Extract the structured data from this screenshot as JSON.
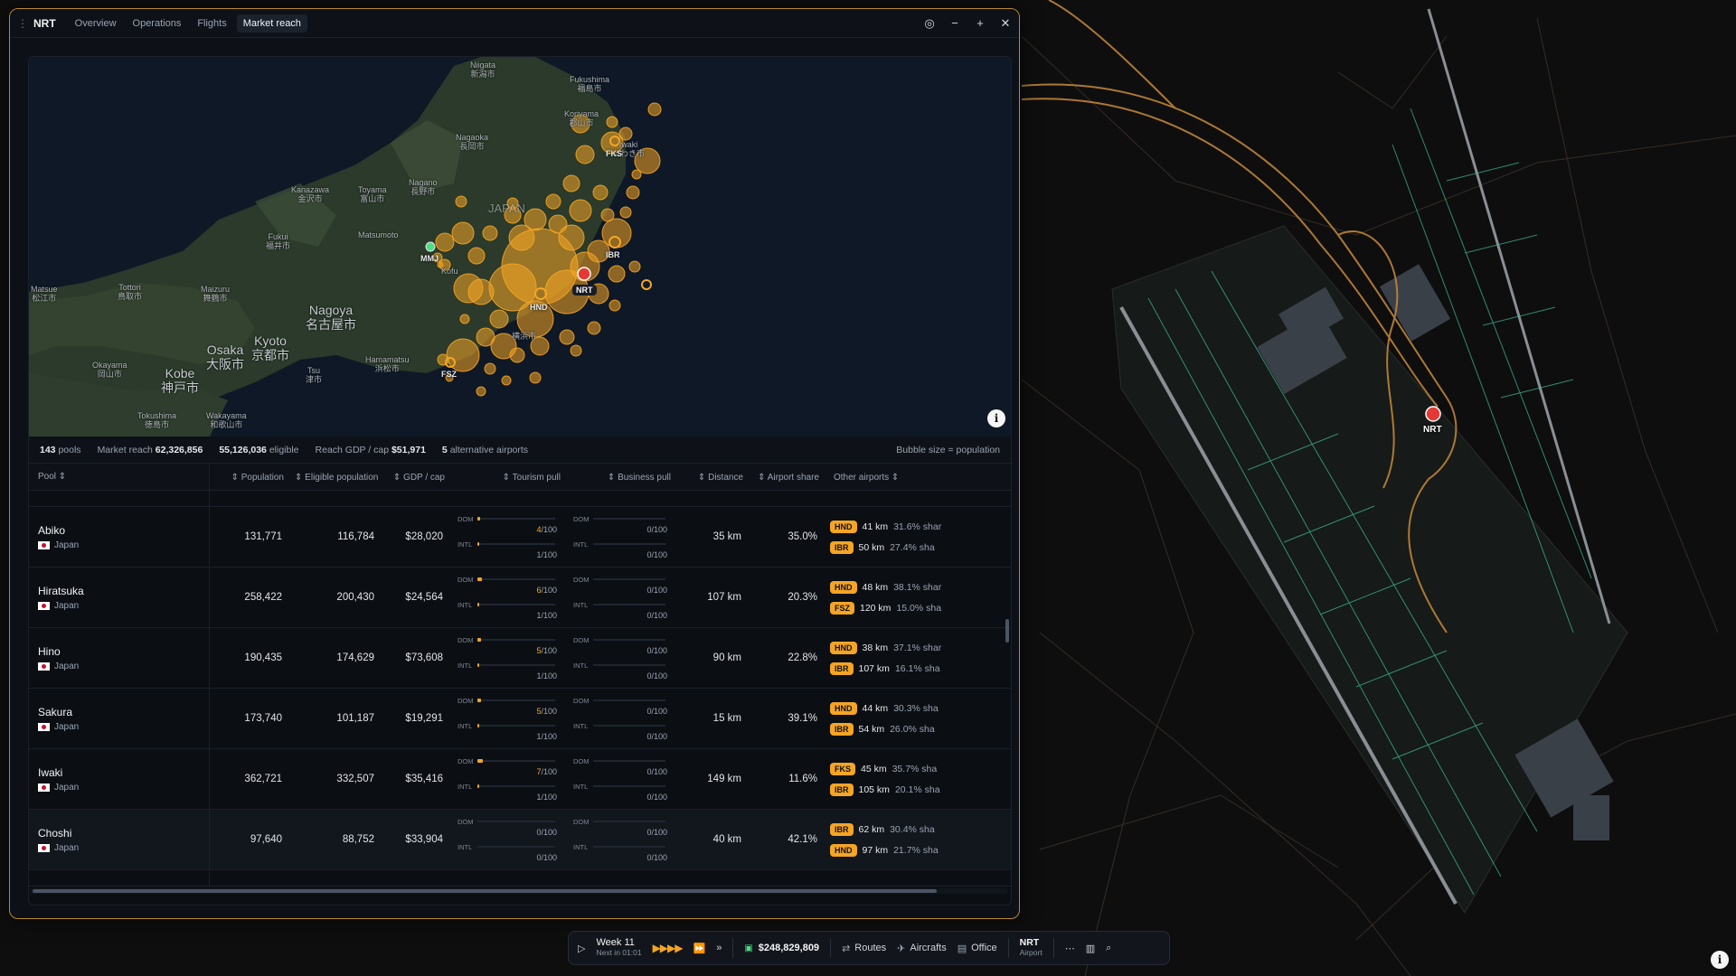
{
  "window": {
    "title": "NRT",
    "tabs": [
      "Overview",
      "Operations",
      "Flights",
      "Market reach"
    ],
    "active_tab": "Market reach"
  },
  "map": {
    "labels": {
      "niigata": "Niigata\n新潟市",
      "fukushima": "Fukushima\n福島市",
      "koriyama": "Koriyama\n郡山市",
      "nagaoka": "Nagaoka\n長岡市",
      "iwaki": "Iwaki\nいわき市",
      "nagano": "Nagano\n長野市",
      "kanazawa": "Kanazawa\n金沢市",
      "toyama": "Toyama\n富山市",
      "japan": "JAPAN",
      "fukui": "Fukui\n福井市",
      "matsumoto": "Matsumoto",
      "kofu": "Kofu",
      "matsue": "Matsue\n松江市",
      "tottori": "Tottori\n鳥取市",
      "maizuru": "Maizuru\n舞鶴市",
      "nagoya": "Nagoya\n名古屋市",
      "kyoto": "Kyoto\n京都市",
      "osaka": "Osaka\n大阪市",
      "kobe": "Kobe\n神戸市",
      "okayama": "Okayama\n岡山市",
      "tsu": "Tsu\n津市",
      "hamamatsu": "Hamamatsu\n浜松市",
      "tokushima": "Tokushima\n徳島市",
      "wakayama": "Wakayama\n和歌山市",
      "yokohama": "横浜市"
    },
    "airports": [
      "NRT",
      "HND",
      "IBR",
      "FKS",
      "MMJ",
      "FSZ"
    ],
    "info_icon": "info-icon"
  },
  "stats": {
    "pools_value": "143",
    "pools_label": "pools",
    "reach_label": "Market reach",
    "reach_value": "62,326,856",
    "eligible_value": "55,126,036",
    "eligible_label": "eligible",
    "gdp_label": "Reach GDP / cap",
    "gdp_value": "$51,971",
    "alt_value": "5",
    "alt_label": "alternative airports",
    "bubble_note": "Bubble size = population"
  },
  "columns": [
    "Pool",
    "Population",
    "Eligible population",
    "GDP / cap",
    "Tourism pull",
    "Business pull",
    "Distance",
    "Airport share",
    "Other airports"
  ],
  "rows": [
    {
      "name": "Abiko",
      "country": "Japan",
      "population": "131,771",
      "eligible": "116,784",
      "gdp": "$28,020",
      "t_dom": "4",
      "t_intl": "1",
      "b_dom": "0",
      "b_intl": "0",
      "t_dom_pct": 0.04,
      "t_intl_pct": 0.01,
      "distance": "35 km",
      "share": "35.0%",
      "others": [
        {
          "code": "HND",
          "dist": "41 km",
          "share": "31.6% shar"
        },
        {
          "code": "IBR",
          "dist": "50 km",
          "share": "27.4% sha"
        }
      ]
    },
    {
      "name": "Hiratsuka",
      "country": "Japan",
      "population": "258,422",
      "eligible": "200,430",
      "gdp": "$24,564",
      "t_dom": "6",
      "t_intl": "1",
      "b_dom": "0",
      "b_intl": "0",
      "t_dom_pct": 0.06,
      "t_intl_pct": 0.01,
      "distance": "107 km",
      "share": "20.3%",
      "others": [
        {
          "code": "HND",
          "dist": "48 km",
          "share": "38.1% shar"
        },
        {
          "code": "FSZ",
          "dist": "120 km",
          "share": "15.0% sha"
        }
      ]
    },
    {
      "name": "Hino",
      "country": "Japan",
      "population": "190,435",
      "eligible": "174,629",
      "gdp": "$73,608",
      "t_dom": "5",
      "t_intl": "1",
      "b_dom": "0",
      "b_intl": "0",
      "t_dom_pct": 0.05,
      "t_intl_pct": 0.01,
      "distance": "90 km",
      "share": "22.8%",
      "others": [
        {
          "code": "HND",
          "dist": "38 km",
          "share": "37.1% shar"
        },
        {
          "code": "IBR",
          "dist": "107 km",
          "share": "16.1% sha"
        }
      ]
    },
    {
      "name": "Sakura",
      "country": "Japan",
      "population": "173,740",
      "eligible": "101,187",
      "gdp": "$19,291",
      "t_dom": "5",
      "t_intl": "1",
      "b_dom": "0",
      "b_intl": "0",
      "t_dom_pct": 0.05,
      "t_intl_pct": 0.01,
      "distance": "15 km",
      "share": "39.1%",
      "others": [
        {
          "code": "HND",
          "dist": "44 km",
          "share": "30.3% sha"
        },
        {
          "code": "IBR",
          "dist": "54 km",
          "share": "26.0% sha"
        }
      ]
    },
    {
      "name": "Iwaki",
      "country": "Japan",
      "population": "362,721",
      "eligible": "332,507",
      "gdp": "$35,416",
      "t_dom": "7",
      "t_intl": "1",
      "b_dom": "0",
      "b_intl": "0",
      "t_dom_pct": 0.07,
      "t_intl_pct": 0.01,
      "distance": "149 km",
      "share": "11.6%",
      "others": [
        {
          "code": "FKS",
          "dist": "45 km",
          "share": "35.7% sha"
        },
        {
          "code": "IBR",
          "dist": "105 km",
          "share": "20.1% sha"
        }
      ]
    },
    {
      "name": "Choshi",
      "country": "Japan",
      "population": "97,640",
      "eligible": "88,752",
      "gdp": "$33,904",
      "t_dom": "0",
      "t_intl": "0",
      "b_dom": "0",
      "b_intl": "0",
      "t_dom_pct": 0,
      "t_intl_pct": 0,
      "distance": "40 km",
      "share": "42.1%",
      "others": [
        {
          "code": "IBR",
          "dist": "62 km",
          "share": "30.4% sha"
        },
        {
          "code": "HND",
          "dist": "97 km",
          "share": "21.7% sha"
        }
      ]
    }
  ],
  "pull_labels": {
    "dom": "DOM",
    "intl": "INTL",
    "max": "/100"
  },
  "dock": {
    "week": "Week 11",
    "next": "Next in 01:01",
    "speed": "▶▶▶▶",
    "money": "$248,829,809",
    "routes": "Routes",
    "aircrafts": "Aircrafts",
    "office": "Office",
    "airport_code": "NRT",
    "airport_label": "Airport"
  },
  "bg_map": {
    "airport_marker": "NRT"
  },
  "colors": {
    "accent": "#f5a524",
    "window_border": "#b8892e",
    "marker": "#e53935",
    "taxiway": "#3fbf9a"
  }
}
